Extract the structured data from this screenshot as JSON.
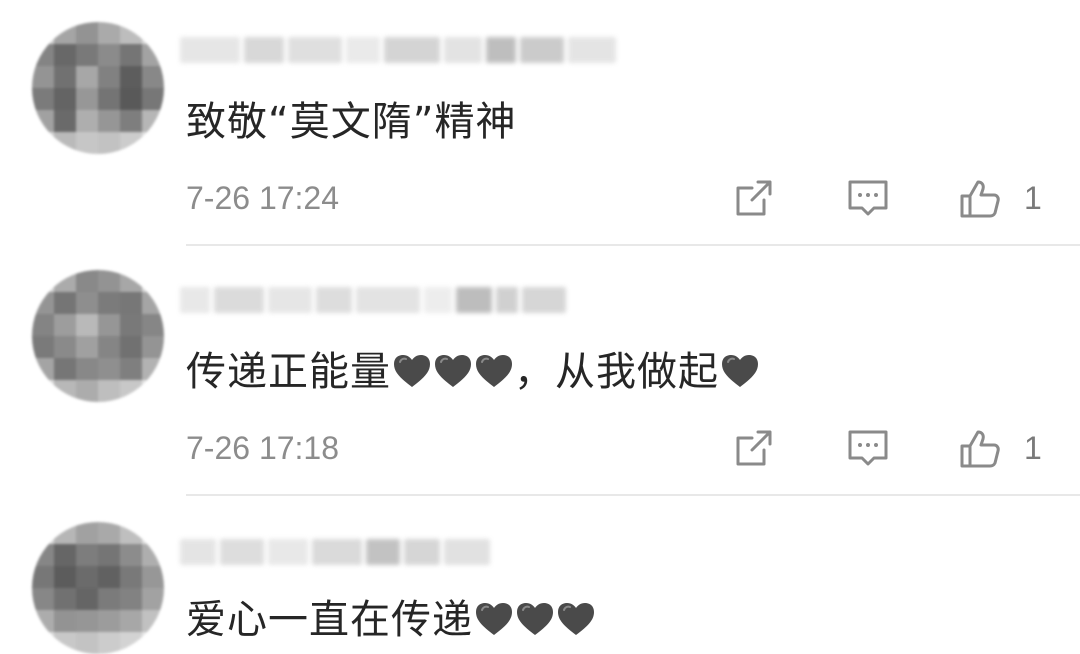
{
  "comments": [
    {
      "text_parts": [
        "致敬“莫文隋”精神"
      ],
      "timestamp": "7-26 17:24",
      "likes": "1",
      "hearts_after_text": 0
    },
    {
      "text_parts": [
        "传递正能量",
        "，从我做起"
      ],
      "timestamp": "7-26 17:18",
      "likes": "1"
    },
    {
      "text_parts": [
        "爱心一直在传递"
      ],
      "timestamp": "",
      "likes": ""
    }
  ],
  "icons": {
    "share": "share-icon",
    "reply": "comment-reply-icon",
    "like": "thumbs-up-icon",
    "heart": "heart-emoji-icon"
  },
  "colors": {
    "text": "#262626",
    "meta": "#8c8c8c",
    "icon": "#8a8a8a",
    "heart": "#4a4a4a",
    "divider": "#e8e8e8"
  }
}
